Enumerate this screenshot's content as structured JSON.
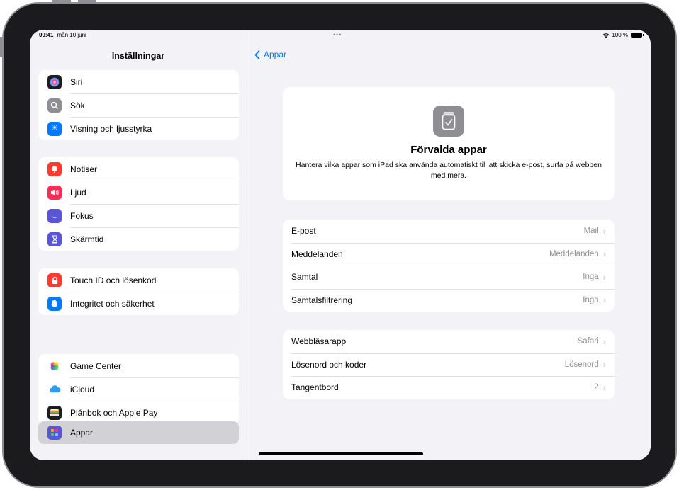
{
  "status": {
    "time": "09:41",
    "date": "mån 10 juni",
    "battery": "100 %"
  },
  "sidebar": {
    "title": "Inställningar",
    "groups": [
      {
        "items": [
          {
            "label": "Siri",
            "icon": "siri-icon",
            "color": "#1c1c1e"
          },
          {
            "label": "Sök",
            "icon": "search-icon",
            "color": "#8e8e93"
          },
          {
            "label": "Visning och ljusstyrka",
            "icon": "brightness-icon",
            "color": "#007aff"
          }
        ]
      },
      {
        "items": [
          {
            "label": "Notiser",
            "icon": "bell-icon",
            "color": "#ff3b30"
          },
          {
            "label": "Ljud",
            "icon": "speaker-icon",
            "color": "#ff2d55"
          },
          {
            "label": "Fokus",
            "icon": "moon-icon",
            "color": "#5856d6"
          },
          {
            "label": "Skärmtid",
            "icon": "hourglass-icon",
            "color": "#5856d6"
          }
        ]
      },
      {
        "items": [
          {
            "label": "Touch ID och lösenkod",
            "icon": "lock-icon",
            "color": "#ff3b30"
          },
          {
            "label": "Integritet och säkerhet",
            "icon": "hand-icon",
            "color": "#007aff"
          }
        ]
      },
      {
        "items": [
          {
            "label": "Game Center",
            "icon": "game-center-icon",
            "color": "#ffffff"
          },
          {
            "label": "iCloud",
            "icon": "cloud-icon",
            "color": "#ffffff"
          },
          {
            "label": "Plånbok och Apple Pay",
            "icon": "wallet-icon",
            "color": "#1c1c1e"
          }
        ]
      }
    ],
    "selected": {
      "label": "Appar",
      "icon": "apps-icon",
      "color": "#5856d6"
    }
  },
  "detail": {
    "back_label": "Appar",
    "hero": {
      "title": "Förvalda appar",
      "description": "Hantera vilka appar som iPad ska använda automatiskt till att skicka e-post, surfa på webben med mera.",
      "icon": "default-apps-icon"
    },
    "groups": [
      {
        "rows": [
          {
            "label": "E-post",
            "value": "Mail"
          },
          {
            "label": "Meddelanden",
            "value": "Meddelanden"
          },
          {
            "label": "Samtal",
            "value": "Inga"
          },
          {
            "label": "Samtalsfiltrering",
            "value": "Inga"
          }
        ]
      },
      {
        "rows": [
          {
            "label": "Webbläsarapp",
            "value": "Safari"
          },
          {
            "label": "Lösenord och koder",
            "value": "Lösenord"
          },
          {
            "label": "Tangentbord",
            "value": "2"
          }
        ]
      }
    ]
  }
}
